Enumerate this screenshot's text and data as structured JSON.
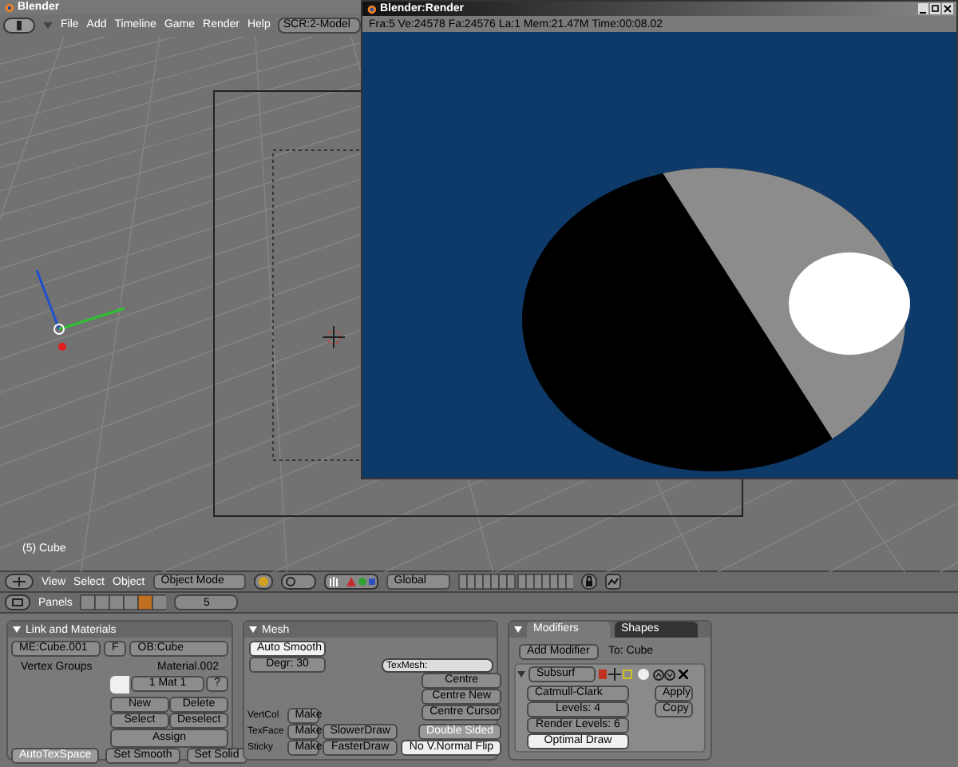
{
  "main_window": {
    "title": "Blender"
  },
  "menu": [
    "File",
    "Add",
    "Timeline",
    "Game",
    "Render",
    "Help"
  ],
  "screen_selector": "SCR:2-Model",
  "viewport": {
    "object_label": "(5) Cube"
  },
  "viewport_header": {
    "menus": [
      "View",
      "Select",
      "Object"
    ],
    "mode": "Object Mode",
    "orientation": "Global"
  },
  "buttons_header": {
    "label": "Panels",
    "frame": "5"
  },
  "link_materials": {
    "title": "Link and Materials",
    "mesh_name": "ME:Cube.001",
    "f_label": "F",
    "object_name": "OB:Cube",
    "vertex_groups_label": "Vertex Groups",
    "material_label": "Material.002",
    "material_index": "1 Mat 1",
    "question": "?",
    "buttons": [
      "New",
      "Delete",
      "Select",
      "Deselect"
    ],
    "assign": "Assign",
    "autotex": "AutoTexSpace",
    "smooth": "Set Smooth",
    "solid": "Set Solid"
  },
  "mesh": {
    "title": "Mesh",
    "auto_smooth": "Auto Smooth",
    "degr": "Degr: 30",
    "texmesh": "TexMesh:",
    "centre_buttons": [
      "Centre",
      "Centre New",
      "Centre Cursor"
    ],
    "make_rows": [
      {
        "label": "VertCol",
        "button": "Make"
      },
      {
        "label": "TexFace",
        "button": "Make"
      },
      {
        "label": "Sticky",
        "button": "Make"
      }
    ],
    "draw_buttons": [
      "SlowerDraw",
      "FasterDraw"
    ],
    "toggles": [
      {
        "label": "Double Sided",
        "on": false
      },
      {
        "label": "No V.Normal Flip",
        "on": true
      }
    ]
  },
  "modifiers": {
    "tabs": [
      {
        "label": "Modifiers",
        "selected": true
      },
      {
        "label": "Shapes",
        "selected": false
      }
    ],
    "add_modifier": "Add Modifier",
    "to": "To: Cube",
    "modifier": {
      "name": "Subsurf",
      "type": "Catmull-Clark",
      "levels": "Levels: 4",
      "render_levels": "Render Levels: 6",
      "optimal_draw": {
        "label": "Optimal Draw",
        "on": true
      }
    },
    "apply": "Apply",
    "copy": "Copy"
  },
  "render_window": {
    "title": "Blender:Render",
    "stats": "Fra:5  Ve:24578 Fa:24576 La:1 Mem:21.47M Time:00:08.02"
  }
}
